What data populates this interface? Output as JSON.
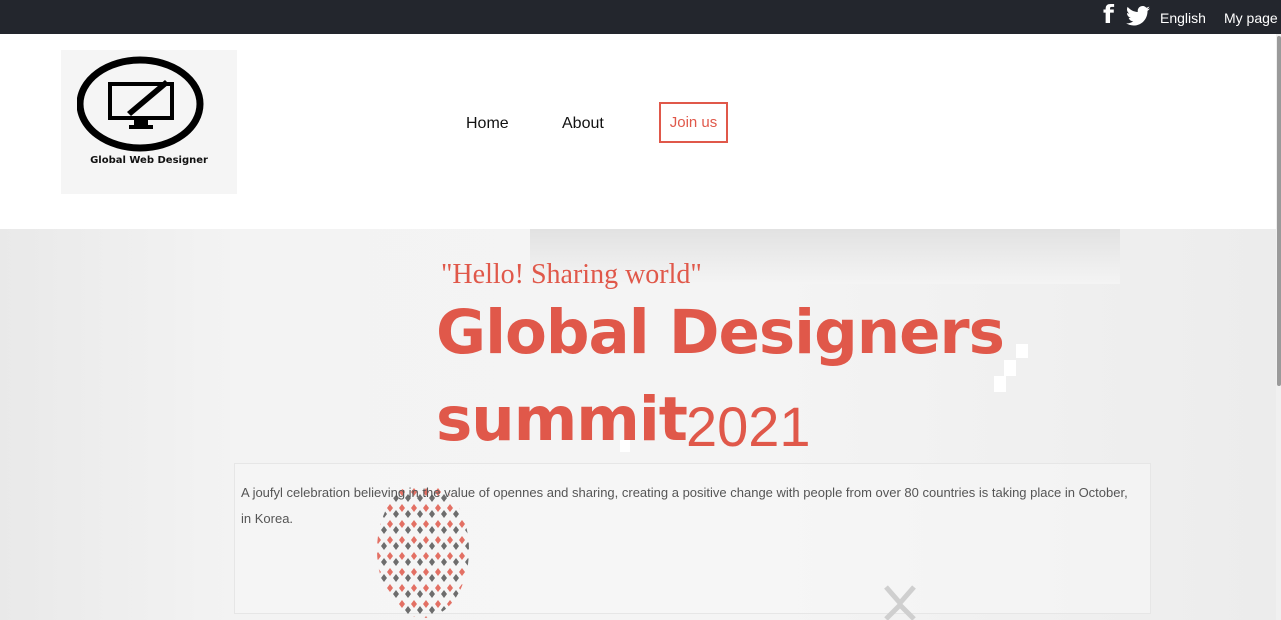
{
  "topbar": {
    "facebook_icon": "facebook-icon",
    "twitter_icon": "twitter-icon",
    "language": "English",
    "my_page": "My page"
  },
  "logo": {
    "text": "Global Web Designer"
  },
  "nav": {
    "home": "Home",
    "about": "About",
    "join": "Join us"
  },
  "hero": {
    "tagline": "\"Hello! Sharing world\"",
    "title_line1": "Global Designers",
    "title_line2": "summit",
    "title_year": "2021",
    "description": "A joufyl celebration believing in the value of opennes and sharing, creating a positive change with people from over 80 countries is taking place in October, in Korea."
  },
  "colors": {
    "accent": "#e0584a",
    "topbar_bg": "#23262d"
  }
}
